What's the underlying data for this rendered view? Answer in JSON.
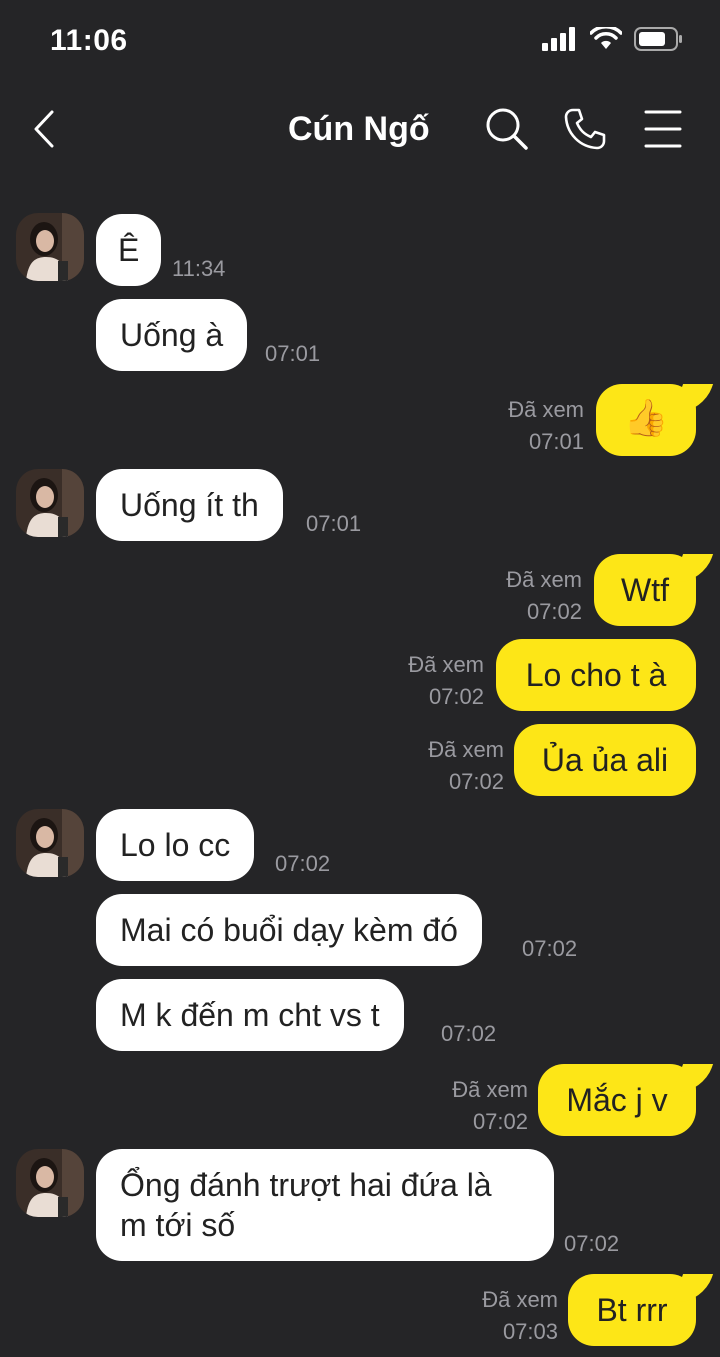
{
  "status_bar": {
    "time": "11:06"
  },
  "header": {
    "title": "Cún Ngố"
  },
  "messages": [
    {
      "dir": "in",
      "text": "Ê",
      "time": "11:34"
    },
    {
      "dir": "in",
      "text": "Uống à",
      "time": "07:01"
    },
    {
      "dir": "out",
      "text": "👍",
      "seen": "Đã xem",
      "time": "07:01"
    },
    {
      "dir": "in",
      "text": "Uống ít th",
      "time": "07:01"
    },
    {
      "dir": "out",
      "text": "Wtf",
      "seen": "Đã xem",
      "time": "07:02"
    },
    {
      "dir": "out",
      "text": "Lo cho t à",
      "seen": "Đã xem",
      "time": "07:02"
    },
    {
      "dir": "out",
      "text": "Ủa ủa ali",
      "seen": "Đã xem",
      "time": "07:02"
    },
    {
      "dir": "in",
      "text": "Lo lo cc",
      "time": "07:02"
    },
    {
      "dir": "in",
      "text": "Mai có buổi dạy kèm đó",
      "time": "07:02"
    },
    {
      "dir": "in",
      "text": "M k đến m cht vs t",
      "time": "07:02"
    },
    {
      "dir": "out",
      "text": "Mắc j v",
      "seen": "Đã xem",
      "time": "07:02"
    },
    {
      "dir": "in",
      "text": "Ổng đánh trượt hai đứa là",
      "text2": "m tới số",
      "time": "07:02"
    },
    {
      "dir": "out",
      "text": "Bt rrr",
      "seen": "Đã xem",
      "time": "07:03"
    }
  ]
}
